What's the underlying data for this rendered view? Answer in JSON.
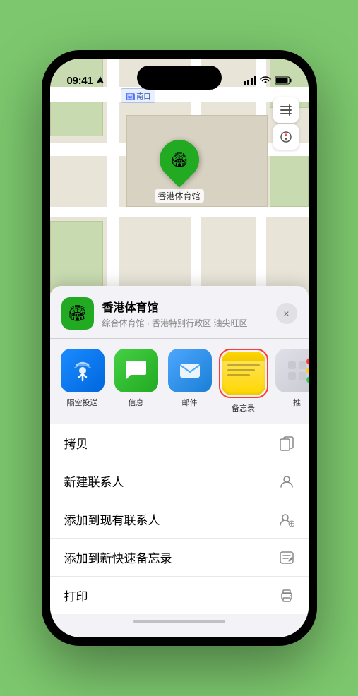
{
  "status": {
    "time": "09:41",
    "location_arrow": "▶"
  },
  "map": {
    "label_text": "南口",
    "label_prefix": "西",
    "pin_label": "香港体育馆",
    "controls": {
      "map_icon": "🗺",
      "location_icon": "➤"
    }
  },
  "venue_card": {
    "name": "香港体育馆",
    "subtitle": "综合体育馆 · 香港特别行政区 油尖旺区",
    "close_label": "×"
  },
  "share_items": [
    {
      "id": "airdrop",
      "label": "隔空投送",
      "emoji": "📡"
    },
    {
      "id": "messages",
      "label": "信息",
      "emoji": "💬"
    },
    {
      "id": "mail",
      "label": "邮件",
      "emoji": "✉"
    },
    {
      "id": "notes",
      "label": "备忘录",
      "emoji": ""
    },
    {
      "id": "more",
      "label": "推",
      "emoji": ""
    }
  ],
  "actions": [
    {
      "label": "拷贝",
      "icon": "⎘"
    },
    {
      "label": "新建联系人",
      "icon": "👤"
    },
    {
      "label": "添加到现有联系人",
      "icon": "👤+"
    },
    {
      "label": "添加到新快速备忘录",
      "icon": "📋"
    },
    {
      "label": "打印",
      "icon": "🖨"
    }
  ]
}
